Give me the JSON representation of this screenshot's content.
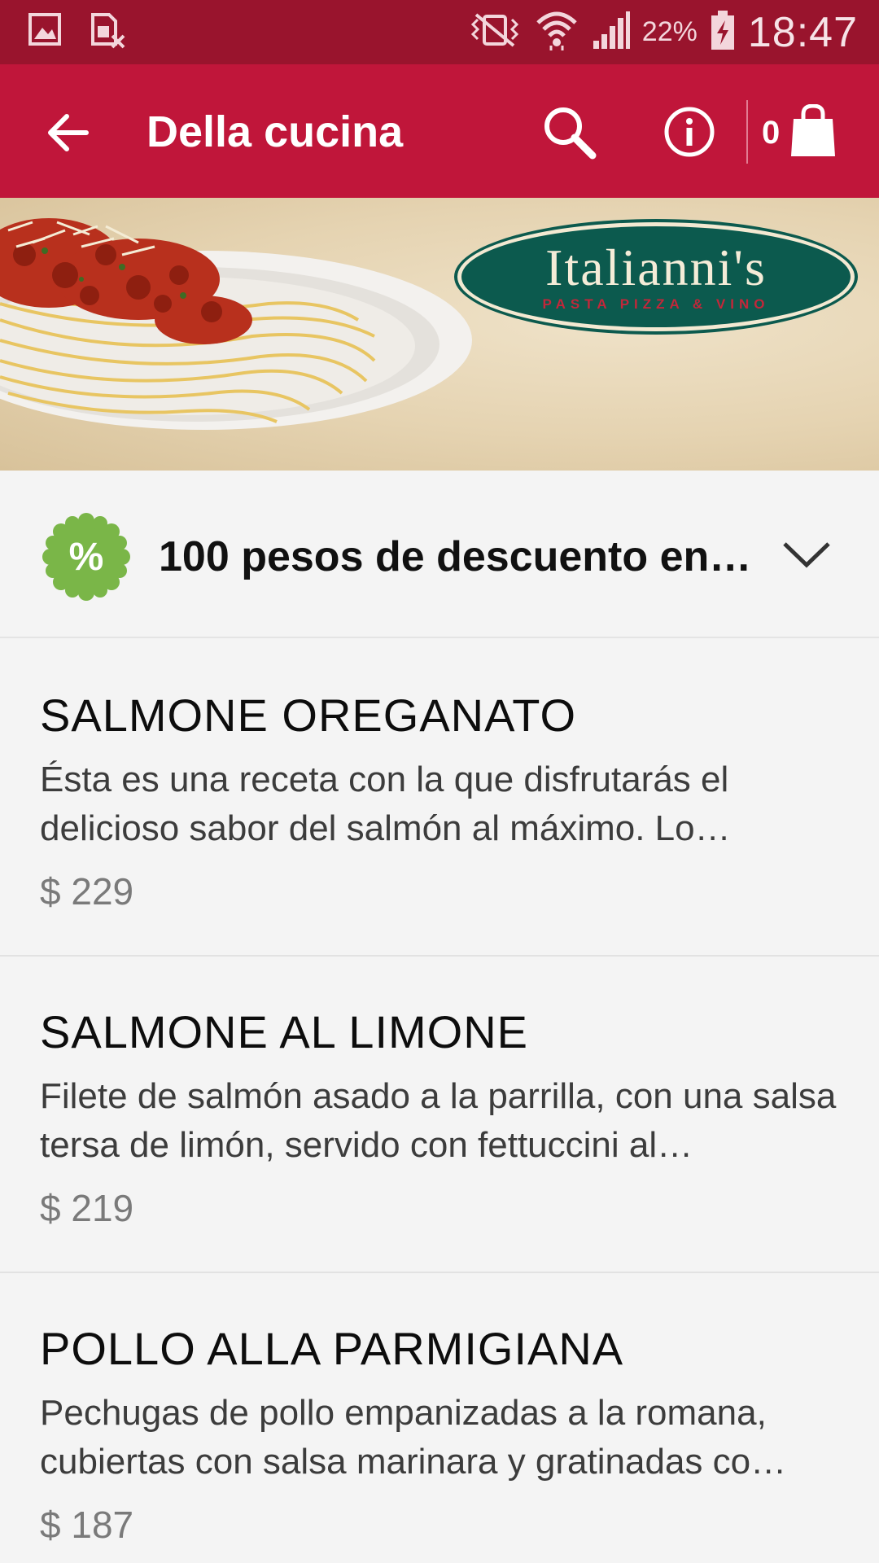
{
  "status_bar": {
    "battery_percent": "22%",
    "clock": "18:47",
    "icons": [
      "image-icon",
      "no-sim-icon",
      "vibrate-icon",
      "wifi-icon",
      "signal-icon",
      "battery-charging-icon"
    ]
  },
  "app_bar": {
    "title": "Della cucina",
    "cart_count": "0",
    "icons": [
      "back-arrow-icon",
      "search-icon",
      "info-icon",
      "shopping-bag-icon"
    ]
  },
  "hero": {
    "logo_name": "Italianni's",
    "logo_tagline": "PASTA PIZZA & VINO"
  },
  "promo": {
    "badge_symbol": "%",
    "text": "100 pesos de descuento en…",
    "badge_color": "#7ab648"
  },
  "menu": {
    "items": [
      {
        "name": "SALMONE OREGANATO",
        "description": "Ésta es una receta con la que disfrutarás el delicioso sabor del salmón al máximo. Lo…",
        "price": "$ 229"
      },
      {
        "name": "SALMONE AL LIMONE",
        "description": "Filete de salmón asado a la parrilla, con una salsa tersa de limón, servido con fettuccini al…",
        "price": "$ 219"
      },
      {
        "name": "POLLO ALLA PARMIGIANA",
        "description": "Pechugas de pollo empanizadas a la romana, cubiertas con salsa marinara y gratinadas co…",
        "price": "$ 187"
      }
    ]
  },
  "colors": {
    "status_bar": "#99142d",
    "app_bar": "#c0163a",
    "accent": "#c0163a"
  }
}
